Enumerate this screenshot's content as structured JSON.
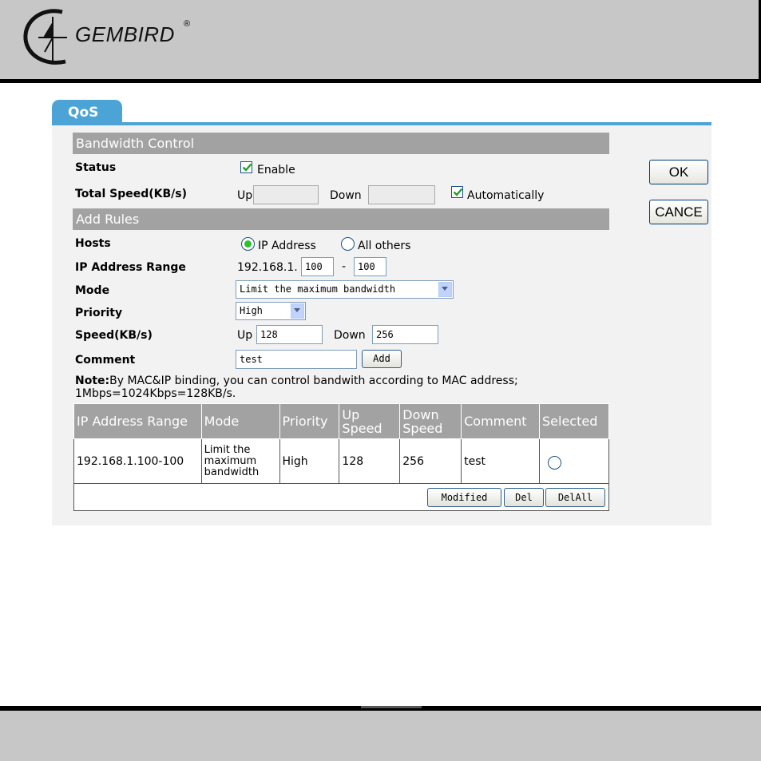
{
  "brand": {
    "name": "GEMBIRD",
    "reg_mark": "®"
  },
  "tab": {
    "label": "QoS"
  },
  "bandwidth_control": {
    "title": "Bandwidth Control",
    "status_label": "Status",
    "enable_label": "Enable",
    "enable_checked": true,
    "total_speed_label": "Total Speed(KB/s)",
    "up_label": "Up",
    "up_value": "",
    "down_label": "Down",
    "down_value": "",
    "auto_label": "Automatically",
    "auto_checked": true
  },
  "add_rules": {
    "title": "Add Rules",
    "hosts_label": "Hosts",
    "host_options": [
      "IP Address",
      "All others"
    ],
    "host_selected": "IP Address",
    "ip_range_label": "IP Address Range",
    "ip_prefix": "192.168.1.",
    "ip_start": "100",
    "ip_dash": "-",
    "ip_end": "100",
    "mode_label": "Mode",
    "mode_value": "Limit the maximum bandwidth",
    "priority_label": "Priority",
    "priority_value": "High",
    "speed_label": "Speed(KB/s)",
    "speed_up_label": "Up",
    "speed_up_value": "128",
    "speed_down_label": "Down",
    "speed_down_value": "256",
    "comment_label": "Comment",
    "comment_value": "test",
    "add_button": "Add"
  },
  "note": {
    "bold": "Note:",
    "line1": "By MAC&IP binding, you can control bandwith according to MAC address;",
    "line2": "1Mbps=1024Kbps=128KB/s."
  },
  "buttons": {
    "ok": "OK",
    "cancel": "CANCE"
  },
  "table": {
    "headers": [
      "IP Address Range",
      "Mode",
      "Priority",
      "Up Speed",
      "Down Speed",
      "Comment",
      "Selected"
    ],
    "rows": [
      {
        "ip_range": "192.168.1.100-100",
        "mode": "Limit the maximum bandwidth",
        "priority": "High",
        "up": "128",
        "down": "256",
        "comment": "test",
        "selected": false
      }
    ],
    "actions": [
      "Modified",
      "Del",
      "DelAll"
    ]
  },
  "colors": {
    "tab_blue": "#4ca3d6",
    "section_gray": "#a2a2a2",
    "header_gray": "#c7c7c7"
  }
}
